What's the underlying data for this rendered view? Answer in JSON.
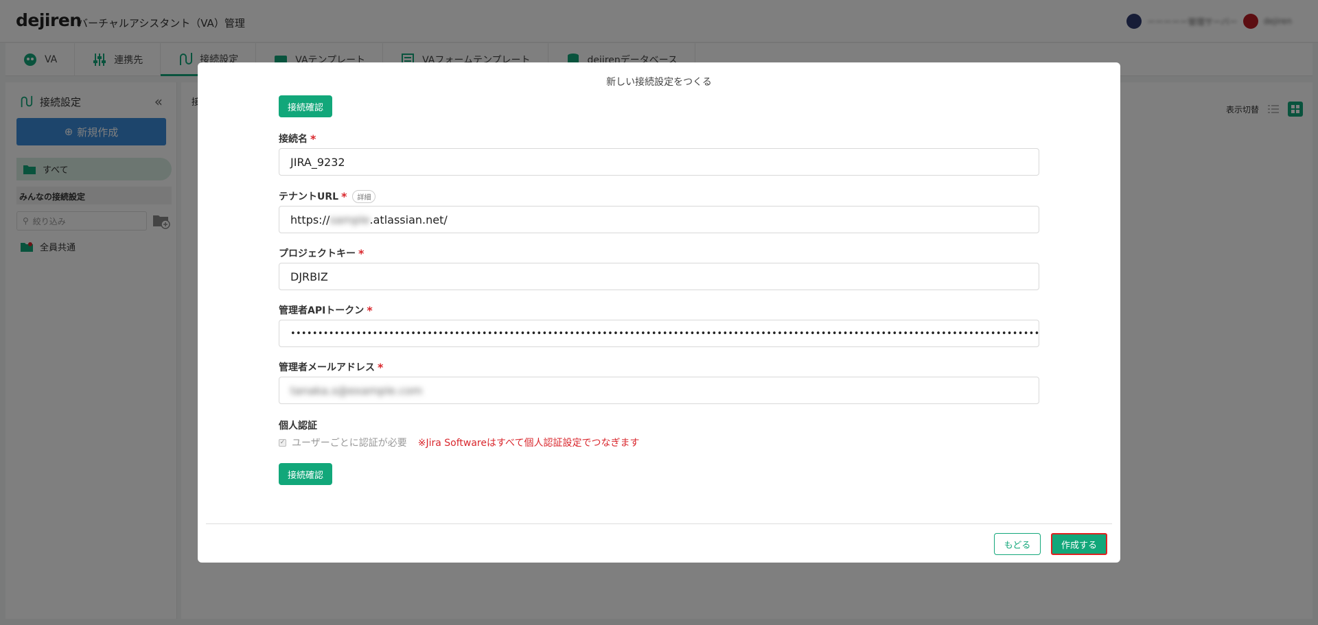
{
  "app": {
    "logo": "dejiren",
    "title": "バーチャルアシスタント（VA）管理",
    "user_names": [
      "ーーーーー管理サーバー",
      "dejiren"
    ]
  },
  "nav": {
    "tabs": [
      {
        "label": "VA",
        "icon": "robot-icon"
      },
      {
        "label": "連携先",
        "icon": "sliders-icon"
      },
      {
        "label": "接続設定",
        "icon": "connection-icon"
      },
      {
        "label": "VAテンプレート",
        "icon": "template-icon"
      },
      {
        "label": "VAフォームテンプレート",
        "icon": "form-template-icon"
      },
      {
        "label": "dejirenデータベース",
        "icon": "database-icon"
      }
    ]
  },
  "sidebar": {
    "title": "接続設定",
    "new_button": "新規作成",
    "all_label": "すべて",
    "section_title": "みんなの接続設定",
    "filter_placeholder": "絞り込み",
    "shared_label": "全員共通"
  },
  "main": {
    "crumb": "接",
    "view_toggle_label": "表示切替"
  },
  "modal": {
    "title": "新しい接続設定をつくる",
    "confirm_button": "接続確認",
    "fields": {
      "connection_name": {
        "label": "接続名",
        "value": "JIRA_9232"
      },
      "tenant_url": {
        "label": "テナントURL",
        "detail": "詳細",
        "prefix": "https://",
        "hidden": "sample",
        "suffix": ".atlassian.net/"
      },
      "project_key": {
        "label": "プロジェクトキー",
        "value": "DJRBIZ"
      },
      "api_token": {
        "label": "管理者APIトークン",
        "value": "••••••••••••••••••••••••••••••••••••••••••••••••••••••••••••••••••••••••••••••••••••••••••••••••••••••••••••••••••••••••••••••••••••••••••••••••••••••••••••••••••••••••••••••••••••••••••••"
      },
      "admin_email": {
        "label": "管理者メールアドレス",
        "value": "tanaka.s@example.com"
      }
    },
    "personal_auth": {
      "label": "個人認証",
      "checkbox_label": "ユーザーごとに認証が必要",
      "checked": true,
      "note": "※Jira Softwareはすべて個人認証設定でつなぎます"
    },
    "back_button": "もどる",
    "create_button": "作成する"
  },
  "colors": {
    "accent": "#12a77a",
    "required": "#d9262c",
    "highlight_border": "#e02020",
    "new_button": "#3b8bd8"
  }
}
